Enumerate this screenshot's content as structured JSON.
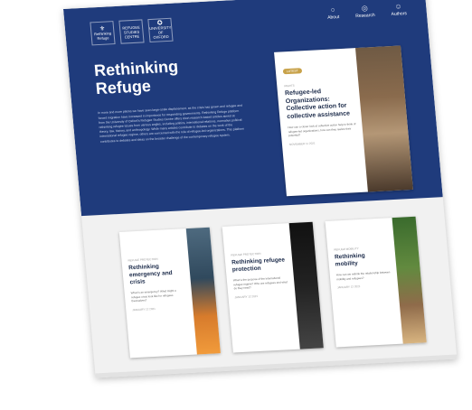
{
  "header": {
    "logos": [
      {
        "icon": "oxford-crest-icon",
        "lines": [
          "Rethinking",
          "Refuge"
        ]
      },
      {
        "icon": "",
        "lines": [
          "REFUGEE",
          "STUDIES",
          "CENTRE"
        ]
      },
      {
        "icon": "university-seal-icon",
        "lines": [
          "UNIVERSITY OF",
          "OXFORD"
        ]
      }
    ],
    "nav": [
      {
        "icon": "info-icon",
        "label": "About"
      },
      {
        "icon": "research-icon",
        "label": "Research"
      },
      {
        "icon": "user-icon",
        "label": "Authors"
      }
    ]
  },
  "hero": {
    "title_line1": "Rethinking",
    "title_line2": "Refuge",
    "intro": "In more and more places we have seen large-scale displacement, as the crisis has grown and refugee and forced migration have increased in importance for responding governments. Rethinking Refuge platform from the University of Oxford's Refugee Studies Centre offers short research-based articles aimed at rethinking refugee issues from various angles, including politics, international relations, normative political theory, law, history, and anthropology. While many articles contribute to debates on the work of the international refugee regime, others are concerned with the role of refugee-led organizations. This platform contributes to debates and ideas on the broader challenge of the contemporary refugee system."
  },
  "featured": {
    "badge": "LATEST",
    "category": "RIGHTS",
    "title": "Refugee-led Organizations: Collective action for collective assistance",
    "excerpt": "How can a closer look at collective action help to think of refugee-led organizations, how can they realize their potential?",
    "date": "NOVEMBER 11 2021"
  },
  "cards": [
    {
      "category": "REFUGE PROTECTION",
      "title": "Rethinking emergency and crisis",
      "excerpt": "What is an emergency? What might a refugee crisis look like for refugees themselves?",
      "date": "JANUARY 12 2021"
    },
    {
      "category": "REFUGE PROTECTION",
      "title": "Rethinking refugee protection",
      "excerpt": "What is the purpose of the international refugee regime? Who are refugees and what do they need?",
      "date": "JANUARY 12 2021"
    },
    {
      "category": "REFUGE MOBILITY",
      "title": "Rethinking mobility",
      "excerpt": "How can we rethink the relationship between mobility and refugees?",
      "date": "JANUARY 12 2021"
    }
  ]
}
